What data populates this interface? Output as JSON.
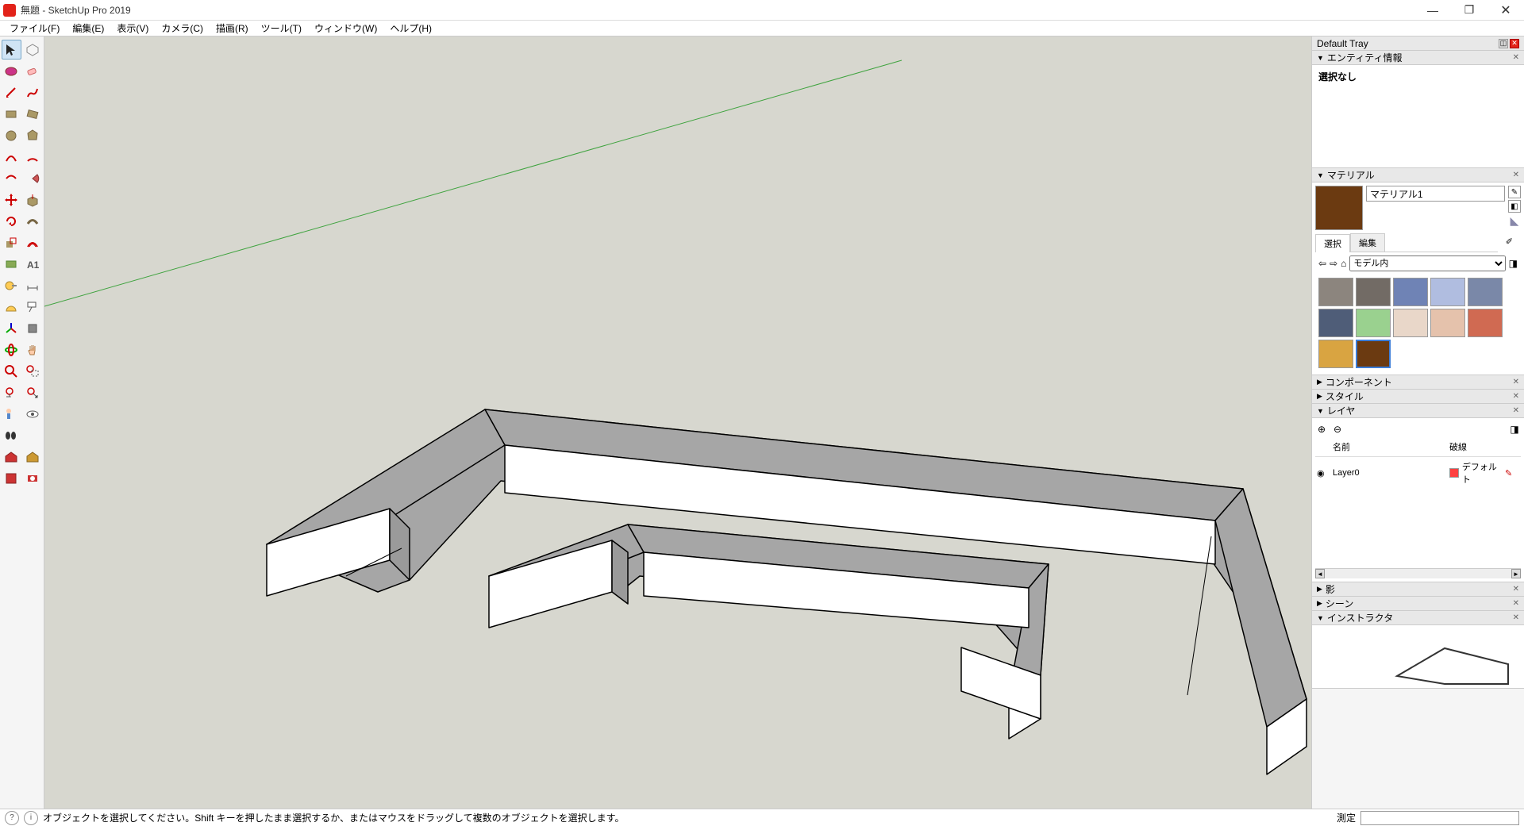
{
  "title": "無題 - SketchUp Pro 2019",
  "menu": [
    "ファイル(F)",
    "編集(E)",
    "表示(V)",
    "カメラ(C)",
    "描画(R)",
    "ツール(T)",
    "ウィンドウ(W)",
    "ヘルプ(H)"
  ],
  "tray": {
    "title": "Default Tray",
    "entity": {
      "head": "エンティティ情報",
      "status": "選択なし"
    },
    "material": {
      "head": "マテリアル",
      "current_name": "マテリアル1",
      "tabs": [
        "選択",
        "編集"
      ],
      "dropdown": "モデル内",
      "swatches": [
        {
          "color": "#8c857e"
        },
        {
          "color": "#726b65"
        },
        {
          "color": "#6f83b5"
        },
        {
          "color": "#b0bde0"
        },
        {
          "color": "#7a88a8"
        },
        {
          "color": "#4f5d78"
        },
        {
          "color": "#9ad18f"
        },
        {
          "color": "#e9d7c9"
        },
        {
          "color": "#e5c2ac"
        },
        {
          "color": "#d06a52"
        },
        {
          "color": "#d9a441"
        },
        {
          "color": "#6b3a11",
          "selected": true
        }
      ]
    },
    "component": {
      "head": "コンポーネント"
    },
    "style": {
      "head": "スタイル"
    },
    "layer": {
      "head": "レイヤ",
      "cols": [
        "名前",
        "破線"
      ],
      "rows": [
        {
          "name": "Layer0",
          "dash": "デフォルト"
        }
      ]
    },
    "shadow": {
      "head": "影"
    },
    "scene": {
      "head": "シーン"
    },
    "instructor": {
      "head": "インストラクタ"
    }
  },
  "status": {
    "hint": "オブジェクトを選択してください。Shift キーを押したまま選択するか、またはマウスをドラッグして複数のオブジェクトを選択します。",
    "measure_label": "測定"
  },
  "tools": [
    [
      "select",
      "wireframe"
    ],
    [
      "paint",
      "eraser"
    ],
    [
      "line",
      "freehand"
    ],
    [
      "rectangle",
      "rotrect"
    ],
    [
      "circle",
      "polygon"
    ],
    [
      "arc",
      "arc2"
    ],
    [
      "arc3",
      "pie"
    ],
    [
      "move",
      "pushpull"
    ],
    [
      "rotate",
      "followme"
    ],
    [
      "scale",
      "offset"
    ],
    [
      "rectangle2",
      "text3d"
    ],
    [
      "tape",
      "dimension"
    ],
    [
      "protractor",
      "text"
    ],
    [
      "axes",
      "section"
    ],
    [
      "orbit",
      "pan"
    ],
    [
      "zoom",
      "zoomwindow"
    ],
    [
      "zoomprev",
      "zoomextents"
    ],
    [
      "position",
      "lookaround"
    ],
    [
      "walk",
      ""
    ],
    [
      "warehouse1",
      "warehouse2"
    ],
    [
      "extension",
      "extension2"
    ]
  ]
}
